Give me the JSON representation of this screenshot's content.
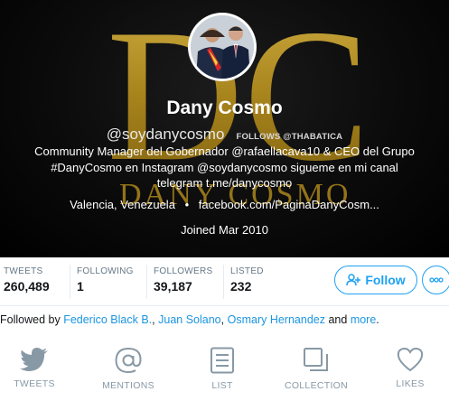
{
  "profile": {
    "name": "Dany Cosmo",
    "handle": "@soydanycosmo",
    "follows_you": "FOLLOWS @THABATICA",
    "bio": "Community Manager del Gobernador @rafaellacava10 & CEO del Grupo #DanyCosmo en Instagram @soydanycosmo sigueme en mi canal telegram t.me/danycosmo",
    "location": "Valencia, Venezuela",
    "separator": "•",
    "website": "facebook.com/PaginaDanyCosm...",
    "joined": "Joined Mar 2010",
    "banner_logo_text": "DC",
    "banner_brand_text": "DANY COSMO"
  },
  "stats": [
    {
      "label": "TWEETS",
      "value": "260,489"
    },
    {
      "label": "FOLLOWING",
      "value": "1"
    },
    {
      "label": "FOLLOWERS",
      "value": "39,187"
    },
    {
      "label": "LISTED",
      "value": "232"
    }
  ],
  "actions": {
    "follow_label": "Follow"
  },
  "followed_by": {
    "prefix": "Followed by",
    "people": [
      "Federico Black B.",
      "Juan Solano",
      "Osmary Hernandez"
    ],
    "and": "and",
    "more": "more",
    "end": "."
  },
  "nav": [
    {
      "label": "TWEETS",
      "icon": "bird-icon"
    },
    {
      "label": "MENTIONS",
      "icon": "at-icon"
    },
    {
      "label": "LIST",
      "icon": "list-icon"
    },
    {
      "label": "COLLECTION",
      "icon": "collection-icon"
    },
    {
      "label": "LIKES",
      "icon": "heart-icon"
    }
  ],
  "colors": {
    "accent": "#1da1f2",
    "link": "#1b95e0",
    "gold": "#c9a227",
    "muted": "#8899a6"
  }
}
